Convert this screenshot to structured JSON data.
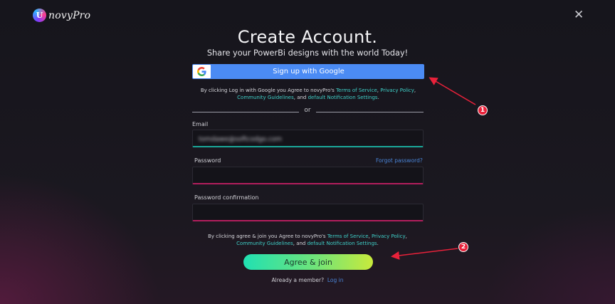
{
  "brand": {
    "name": "novyPro",
    "mark": "U"
  },
  "heading": {
    "title": "Create Account.",
    "subtitle": "Share your PowerBi designs with the world Today!"
  },
  "google": {
    "label": "Sign up with Google"
  },
  "google_terms": {
    "prefix": "By clicking Log in with Google you Agree to novyPro's",
    "terms": "Terms of Service",
    "privacy": "Privacy Policy",
    "community": "Community Guidelines",
    "and": ", and",
    "notification": "default Notification Settings",
    "suffix": "."
  },
  "divider": {
    "or": "or"
  },
  "form": {
    "email_label": "Email",
    "email_value": "tomdawe@softcodgo.com",
    "password_label": "Password",
    "forgot": "Forgot password?",
    "confirm_label": "Password confirmation"
  },
  "join_terms": {
    "prefix": "By clicking agree & join you Agree to novyPro's",
    "terms": "Terms of Service",
    "privacy": "Privacy Policy",
    "community": "Community Guidelines",
    "and": ", and",
    "notification": "default Notification Settings",
    "suffix": "."
  },
  "join": {
    "label": "Agree & join"
  },
  "member": {
    "prompt": "Already a member?",
    "login": "Log in"
  },
  "annotations": [
    {
      "number": "1"
    },
    {
      "number": "2"
    }
  ],
  "colors": {
    "google_blue": "#4b8bf4",
    "link_teal": "#3fd0c9",
    "link_blue": "#4a86d9",
    "email_underline": "#1aa89a",
    "password_underline": "#b21e5d",
    "annotation_red": "#e8213a"
  }
}
